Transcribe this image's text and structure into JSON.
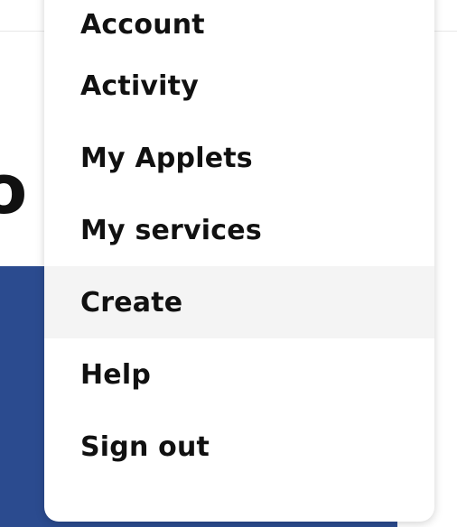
{
  "background": {
    "heading_fragment": "o",
    "banner_color": "#2b4b8f"
  },
  "menu": {
    "items": [
      {
        "label": "Account"
      },
      {
        "label": "Activity"
      },
      {
        "label": "My Applets"
      },
      {
        "label": "My services"
      },
      {
        "label": "Create",
        "highlighted": true
      },
      {
        "label": "Help"
      },
      {
        "label": "Sign out"
      }
    ],
    "highlight_color": "#f4f4f4"
  }
}
